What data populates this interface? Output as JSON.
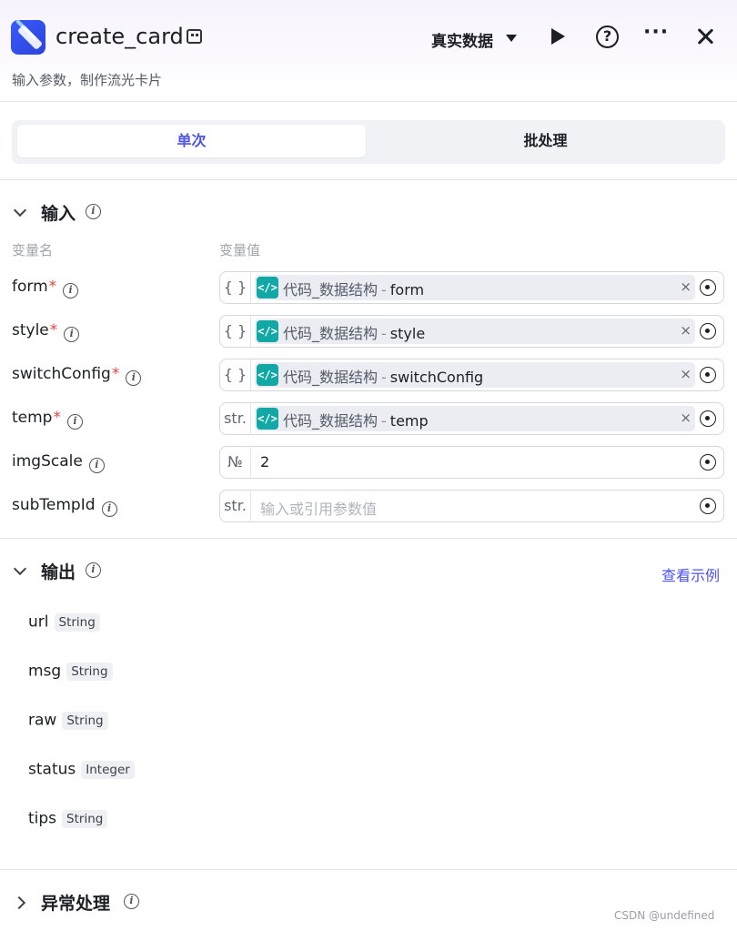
{
  "header": {
    "title": "create_card",
    "subtitle": "输入参数，制作流光卡片",
    "data_mode": "真实数据",
    "help_glyph": "?",
    "more_glyph": "···"
  },
  "mode_tabs": {
    "single": "单次",
    "batch": "批处理",
    "active": "single"
  },
  "input_section": {
    "title": "输入",
    "col_name": "变量名",
    "col_value": "变量值",
    "params": [
      {
        "name": "form",
        "required": true,
        "type_tag": "{ }",
        "kind": "ref",
        "ref_node": "代码_数据结构",
        "ref_var": "form"
      },
      {
        "name": "style",
        "required": true,
        "type_tag": "{ }",
        "kind": "ref",
        "ref_node": "代码_数据结构",
        "ref_var": "style"
      },
      {
        "name": "switchConfig",
        "required": true,
        "type_tag": "{ }",
        "kind": "ref",
        "ref_node": "代码_数据结构",
        "ref_var": "switchConfig"
      },
      {
        "name": "temp",
        "required": true,
        "type_tag": "str.",
        "kind": "ref",
        "ref_node": "代码_数据结构",
        "ref_var": "temp"
      },
      {
        "name": "imgScale",
        "required": false,
        "type_tag": "№",
        "kind": "value",
        "value": "2"
      },
      {
        "name": "subTempId",
        "required": false,
        "type_tag": "str.",
        "kind": "placeholder",
        "placeholder": "输入或引用参数值"
      }
    ],
    "ref_separator": "-",
    "code_glyph": "</>",
    "required_mark": "*",
    "chip_remove": "×"
  },
  "output_section": {
    "title": "输出",
    "example_link": "查看示例",
    "outputs": [
      {
        "name": "url",
        "type": "String"
      },
      {
        "name": "msg",
        "type": "String"
      },
      {
        "name": "raw",
        "type": "String"
      },
      {
        "name": "status",
        "type": "Integer"
      },
      {
        "name": "tips",
        "type": "String"
      }
    ]
  },
  "error_section": {
    "title": "异常处理"
  },
  "watermark": "CSDN @undefined",
  "colors": {
    "accent": "#4d53e8",
    "code_chip": "#11a8a6",
    "required": "#e3463f"
  }
}
